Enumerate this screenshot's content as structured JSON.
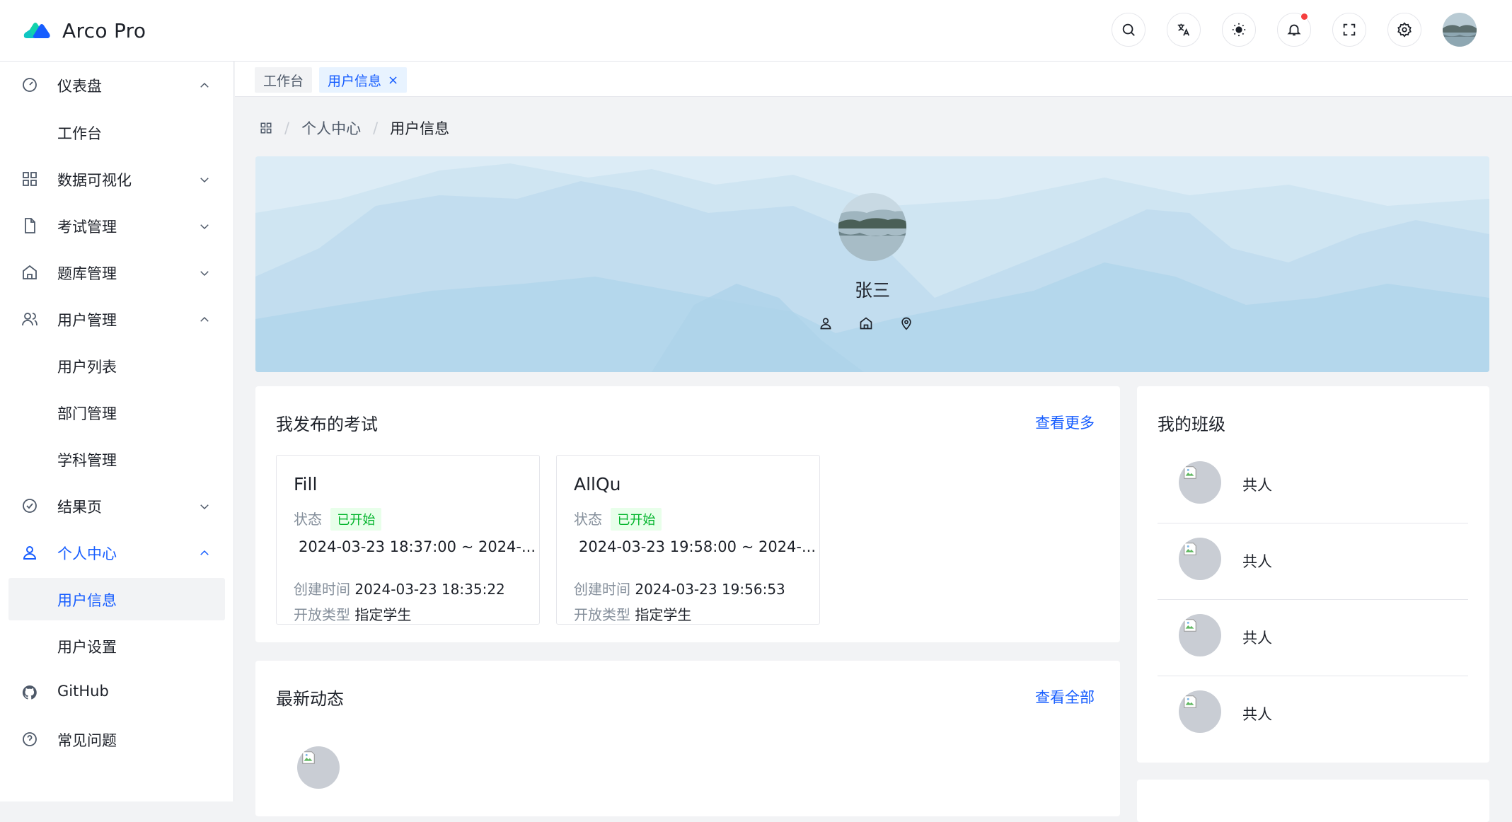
{
  "app": {
    "title": "Arco Pro"
  },
  "navbar": {
    "tools": [
      "search-icon",
      "translate-icon",
      "theme-icon",
      "bell-icon",
      "fullscreen-icon",
      "settings-icon"
    ],
    "has_notification": true
  },
  "sidebar": {
    "items": [
      {
        "label": "仪表盘",
        "icon": "dashboard-icon",
        "expanded": true
      },
      {
        "label": "工作台",
        "sub": true
      },
      {
        "label": "数据可视化",
        "icon": "grid-icon",
        "expanded": false
      },
      {
        "label": "考试管理",
        "icon": "file-icon",
        "expanded": false
      },
      {
        "label": "题库管理",
        "icon": "home-icon",
        "expanded": false
      },
      {
        "label": "用户管理",
        "icon": "user-group-icon",
        "expanded": true
      },
      {
        "label": "用户列表",
        "sub": true
      },
      {
        "label": "部门管理",
        "sub": true
      },
      {
        "label": "学科管理",
        "sub": true
      },
      {
        "label": "结果页",
        "icon": "check-circle-icon",
        "expanded": false
      },
      {
        "label": "个人中心",
        "icon": "user-icon",
        "expanded": true,
        "active": true
      },
      {
        "label": "用户信息",
        "sub": true,
        "selected": true
      },
      {
        "label": "用户设置",
        "sub": true
      },
      {
        "label": "GitHub",
        "icon": "github-icon"
      },
      {
        "label": "常见问题",
        "icon": "question-circle-icon"
      }
    ]
  },
  "tabs": [
    {
      "label": "工作台",
      "active": false
    },
    {
      "label": "用户信息",
      "active": true,
      "close": "×"
    }
  ],
  "breadcrumb": {
    "items": [
      "个人中心",
      "用户信息"
    ],
    "separator": "/"
  },
  "profile": {
    "name": "张三",
    "icons": [
      "user-icon",
      "home-icon",
      "location-icon"
    ]
  },
  "exams_card": {
    "title": "我发布的考试",
    "link": "查看更多",
    "exams": [
      {
        "title": "Fill",
        "status_label": "状态",
        "status": "已开始",
        "time_range": "2024-03-23 18:37:00 ~ 2024-...",
        "created_label": "创建时间",
        "created": "2024-03-23 18:35:22",
        "open_type_label": "开放类型",
        "open_type": "指定学生"
      },
      {
        "title": "AllQu",
        "status_label": "状态",
        "status": "已开始",
        "time_range": "2024-03-23 19:58:00 ~ 2024-...",
        "created_label": "创建时间",
        "created": "2024-03-23 19:56:53",
        "open_type_label": "开放类型",
        "open_type": "指定学生"
      }
    ]
  },
  "activity_card": {
    "title": "最新动态",
    "link": "查看全部"
  },
  "classes_card": {
    "title": "我的班级",
    "items": [
      {
        "name": "共人"
      },
      {
        "name": "共人"
      },
      {
        "name": "共人"
      },
      {
        "name": "共人"
      }
    ]
  },
  "colors": {
    "primary": "#165dff",
    "success_bg": "#e8ffea",
    "success_text": "#00b42a",
    "banner_bg": "#d6eaf6",
    "page_bg": "#f2f3f5"
  }
}
